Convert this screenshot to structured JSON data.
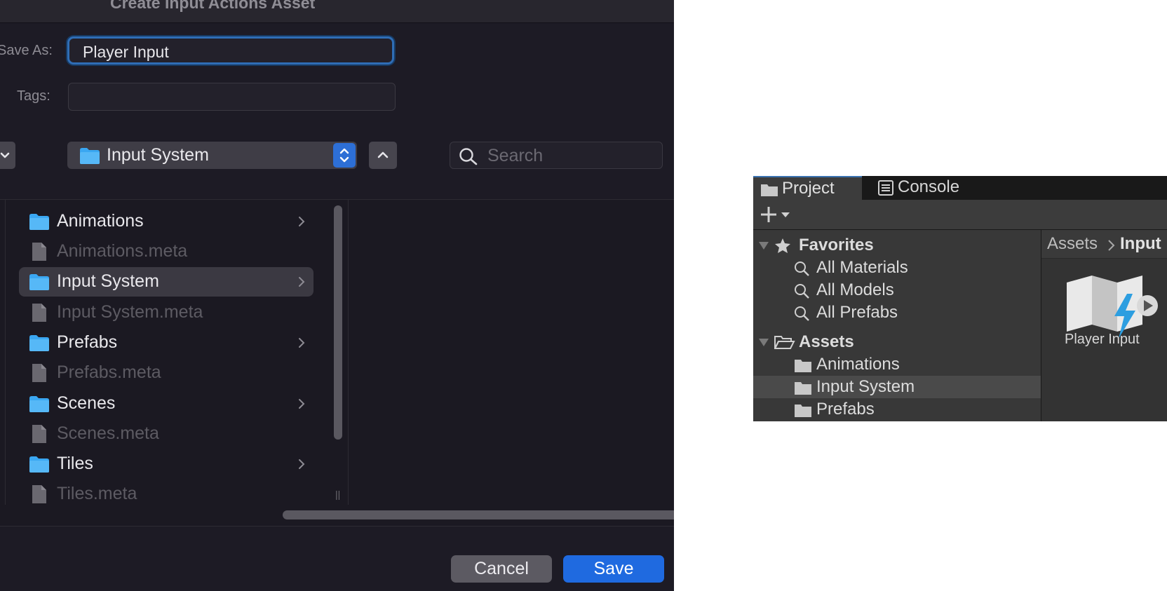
{
  "dialog": {
    "title": "Create Input Actions Asset",
    "save_as_label": "Save As:",
    "save_as_value": "Player Input",
    "tags_label": "Tags:",
    "tags_value": "",
    "location": "Input System",
    "search_placeholder": "Search",
    "files": [
      {
        "name": "Animations",
        "kind": "folder",
        "has_children": true,
        "selected": false
      },
      {
        "name": "Animations.meta",
        "kind": "file",
        "has_children": false,
        "selected": false
      },
      {
        "name": "Input System",
        "kind": "folder",
        "has_children": true,
        "selected": true
      },
      {
        "name": "Input System.meta",
        "kind": "file",
        "has_children": false,
        "selected": false
      },
      {
        "name": "Prefabs",
        "kind": "folder",
        "has_children": true,
        "selected": false
      },
      {
        "name": "Prefabs.meta",
        "kind": "file",
        "has_children": false,
        "selected": false
      },
      {
        "name": "Scenes",
        "kind": "folder",
        "has_children": true,
        "selected": false
      },
      {
        "name": "Scenes.meta",
        "kind": "file",
        "has_children": false,
        "selected": false
      },
      {
        "name": "Tiles",
        "kind": "folder",
        "has_children": true,
        "selected": false
      },
      {
        "name": "Tiles.meta",
        "kind": "file",
        "has_children": false,
        "selected": false
      }
    ],
    "cancel_label": "Cancel",
    "save_label": "Save",
    "colors": {
      "accent": "#1f6ae0",
      "folder": "#3aa7f2",
      "focus_ring": "#2f6db5"
    }
  },
  "unity": {
    "tabs": [
      {
        "label": "Project",
        "icon": "folder-icon",
        "active": true
      },
      {
        "label": "Console",
        "icon": "console-icon",
        "active": false
      }
    ],
    "tree": {
      "favorites_label": "Favorites",
      "favorites": [
        "All Materials",
        "All Models",
        "All Prefabs"
      ],
      "assets_label": "Assets",
      "assets": [
        {
          "name": "Animations",
          "selected": false
        },
        {
          "name": "Input System",
          "selected": true
        },
        {
          "name": "Prefabs",
          "selected": false
        }
      ]
    },
    "breadcrumb": [
      "Assets",
      "Input"
    ],
    "asset": {
      "name": "Player Input",
      "icon": "input-actions-icon"
    }
  }
}
